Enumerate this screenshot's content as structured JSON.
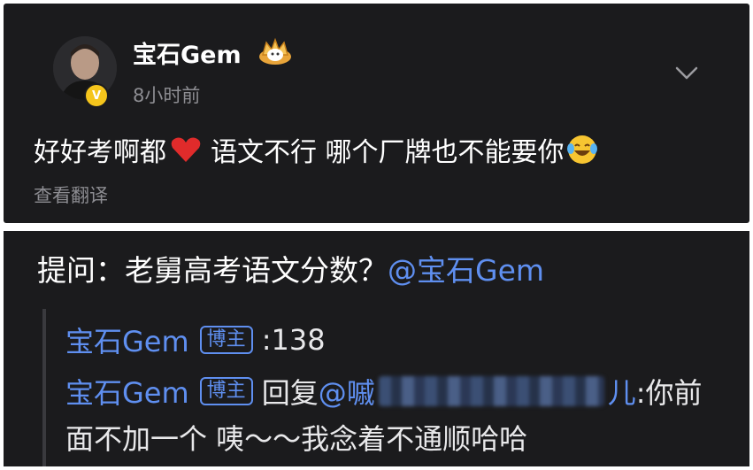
{
  "post": {
    "username": "宝石Gem",
    "verified_badge": "V",
    "timestamp": "8小时前",
    "text_before_heart": "好好考啊都",
    "text_after_heart": " 语文不行 哪个厂牌也不能要你",
    "translate_label": "查看翻译",
    "icons": [
      "avatar",
      "verified-badge-icon",
      "crown-badge-icon",
      "chevron-down-icon",
      "heart-emoji-icon",
      "laughing-crying-emoji-icon"
    ]
  },
  "qa": {
    "question_text": "提问：老舅高考语文分数？",
    "question_mention": "@宝石Gem",
    "replies": [
      {
        "name": "宝石Gem",
        "tag": "博主",
        "separator": ":",
        "content": " 138"
      },
      {
        "name": "宝石Gem",
        "tag": "博主",
        "prefix": "回复",
        "mention_visible_start": "@嘁",
        "mention_visible_end": "儿",
        "after": " :你前",
        "continuation": "面不加一个 咦～～我念着不通顺哈哈"
      }
    ]
  },
  "colors": {
    "background": "#1b1b1d",
    "text": "#ffffff",
    "muted": "#8d8d92",
    "link": "#5f8ff0",
    "badge": "#f5c51c",
    "heart": "#e02b2b"
  }
}
